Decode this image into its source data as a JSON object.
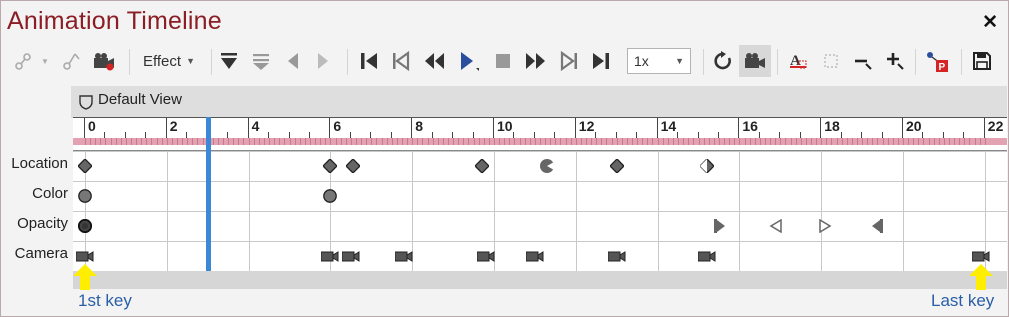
{
  "window": {
    "title": "Animation Timeline",
    "close_glyph": "✕"
  },
  "toolbar": {
    "effect_label": "Effect",
    "speed_value": "1x",
    "icons": [
      "add-motion-path-icon",
      "dropdown-caret-icon",
      "node-icon",
      "camera-record-icon",
      "effect-dropdown",
      "collapse-icon",
      "expand-icon",
      "previous-icon",
      "next-icon",
      "go-to-start-icon",
      "step-back-icon",
      "rewind-icon",
      "play-icon",
      "stop-icon",
      "fast-forward-icon",
      "step-forward-icon",
      "go-to-end-icon",
      "speed-select",
      "loop-icon",
      "camera-icon",
      "text-effect-icon",
      "fit-icon",
      "zoom-out-icon",
      "zoom-in-icon",
      "presentation-icon",
      "save-icon"
    ]
  },
  "view": {
    "label": "Default View",
    "icon": "shield-icon"
  },
  "ruler": {
    "labels": [
      "0",
      "2",
      "4",
      "6",
      "8",
      "10",
      "12",
      "14",
      "16",
      "18",
      "20",
      "22"
    ],
    "playhead_time": 3.0
  },
  "tracks": [
    {
      "name": "Location",
      "keys": [
        {
          "t": 0,
          "shape": "diamond"
        },
        {
          "t": 6,
          "shape": "diamond"
        },
        {
          "t": 6.55,
          "shape": "diamond"
        },
        {
          "t": 9.7,
          "shape": "diamond"
        },
        {
          "t": 11.3,
          "shape": "half-circle"
        },
        {
          "t": 13,
          "shape": "diamond"
        },
        {
          "t": 15.2,
          "shape": "diamond-half"
        }
      ]
    },
    {
      "name": "Color",
      "keys": [
        {
          "t": 0,
          "shape": "circle"
        },
        {
          "t": 6,
          "shape": "circle"
        }
      ]
    },
    {
      "name": "Opacity",
      "keys": [
        {
          "t": 0,
          "shape": "circle-dark"
        },
        {
          "t": 15.5,
          "shape": "flag-right"
        },
        {
          "t": 16.9,
          "shape": "tri-left"
        },
        {
          "t": 18.1,
          "shape": "tri-right"
        },
        {
          "t": 19.4,
          "shape": "flag-left"
        }
      ]
    },
    {
      "name": "Camera",
      "keys": [
        {
          "t": 0,
          "shape": "camera"
        },
        {
          "t": 6,
          "shape": "camera"
        },
        {
          "t": 6.5,
          "shape": "camera"
        },
        {
          "t": 7.8,
          "shape": "camera"
        },
        {
          "t": 9.8,
          "shape": "camera"
        },
        {
          "t": 11,
          "shape": "camera"
        },
        {
          "t": 13,
          "shape": "camera"
        },
        {
          "t": 15.2,
          "shape": "camera"
        },
        {
          "t": 21.9,
          "shape": "camera"
        }
      ]
    }
  ],
  "annotations": {
    "first": "1st key",
    "last": "Last key",
    "color": "#ffee00"
  },
  "colors": {
    "title": "#8b1d24",
    "playhead": "#3a88d6",
    "ruler_band": "#e3a2b2",
    "caption": "#2a5ea8"
  }
}
